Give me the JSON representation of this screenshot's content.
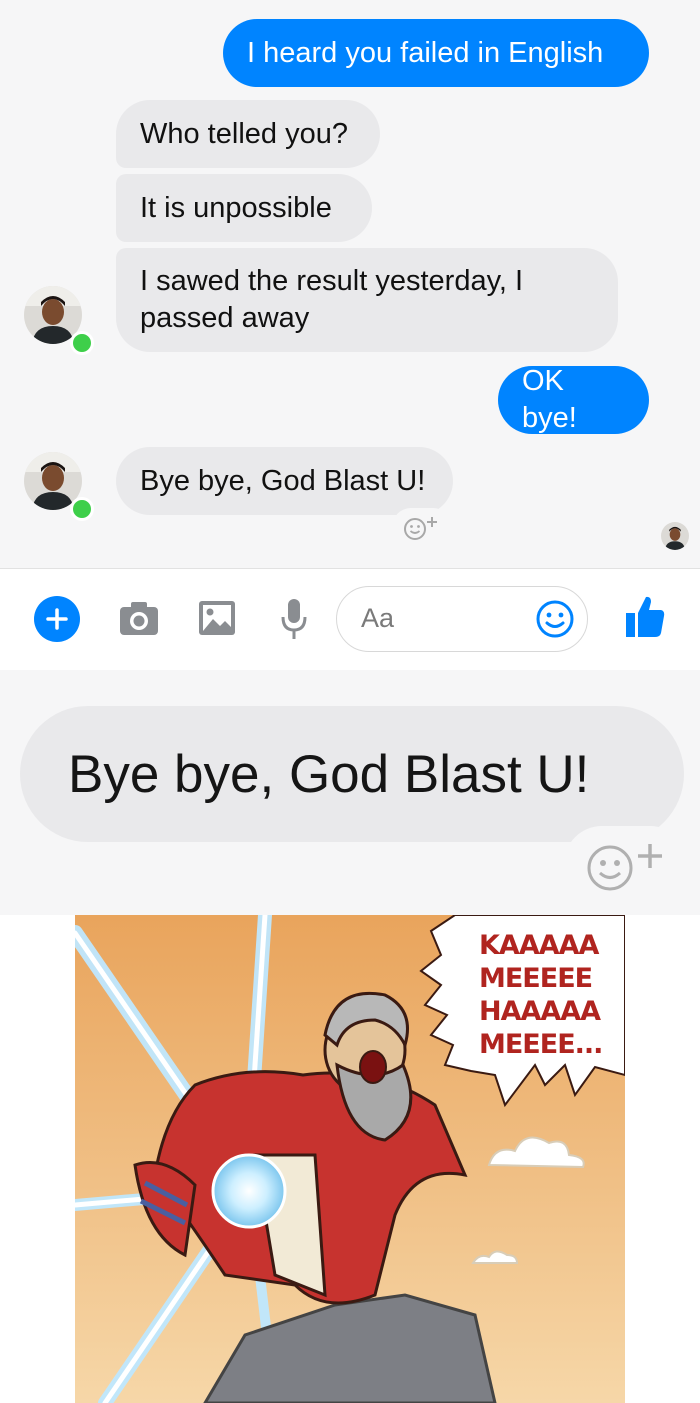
{
  "messages": {
    "m1": "I heard you failed in English",
    "m2": "Who telled you?",
    "m3": "It is unpossible",
    "m4_line1": "I sawed the result yesterday, I",
    "m4_line2": "passed away",
    "m5": "OK bye!",
    "m6": "Bye bye, God Blast U!"
  },
  "composer": {
    "placeholder": "Aa"
  },
  "zoomed": {
    "text": "Bye bye, God Blast U!"
  },
  "cartoon": {
    "speech_lines": [
      "KAAAAA",
      "MEEEEE",
      "HAAAAA",
      "MEEEE..."
    ]
  },
  "colors": {
    "messenger_blue": "#0084ff",
    "incoming_gray": "#e9e9eb",
    "online_green": "#3ecf4a",
    "sky": "#f0b46a",
    "robe_red": "#c7332f",
    "energy": "#bfe8ff"
  },
  "icons": [
    "plus-icon",
    "camera-icon",
    "image-icon",
    "microphone-icon",
    "emoji-icon",
    "thumbs-up-icon",
    "reaction-add-icon"
  ]
}
